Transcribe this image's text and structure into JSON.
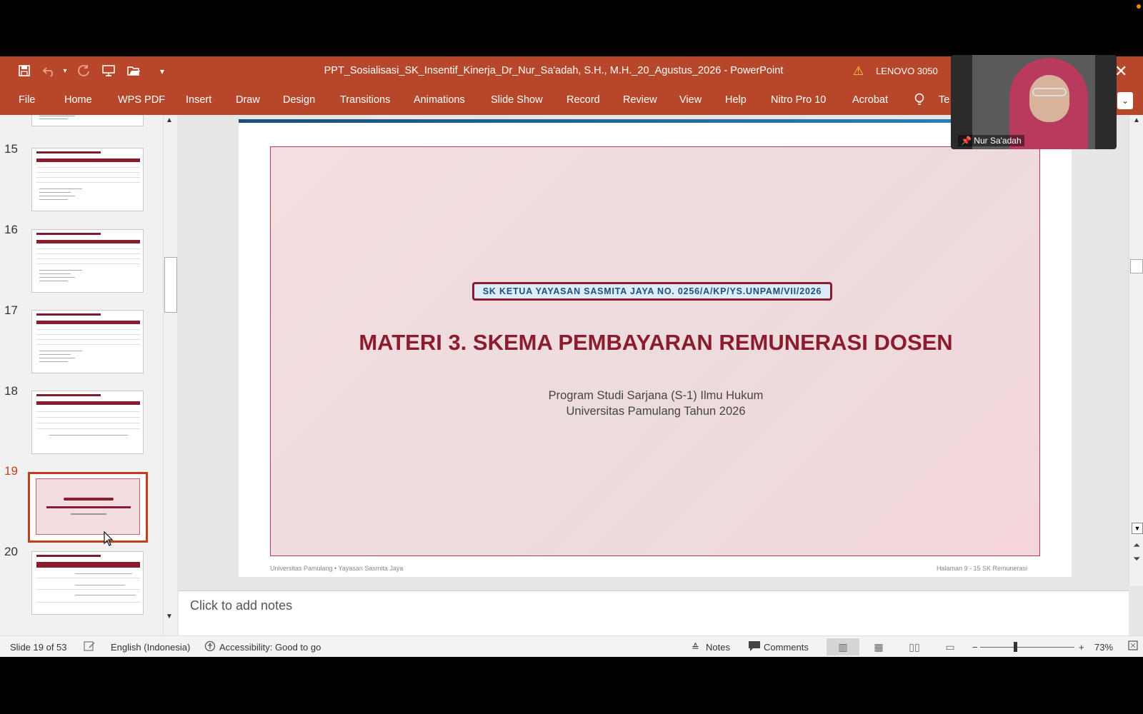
{
  "window": {
    "title": "PPT_Sosialisasi_SK_Insentif_Kinerja_Dr_Nur_Sa'adah, S.H., M.H._20_Agustus_2026  -  PowerPoint",
    "device_name": "LENOVO 3050",
    "close_glyph": "✕"
  },
  "quick_access": {
    "save_icon": "save-icon",
    "undo_icon": "undo-icon",
    "redo_icon": "redo-icon",
    "present_icon": "presentation-icon",
    "open_icon": "folder-open-icon",
    "customize_glyph": "▾"
  },
  "menu": {
    "items": [
      "File",
      "Home",
      "WPS PDF",
      "Insert",
      "Draw",
      "Design",
      "Transitions",
      "Animations",
      "Slide Show",
      "Record",
      "Review",
      "View",
      "Help",
      "Nitro Pro 10",
      "Acrobat"
    ],
    "tell_me": "Te"
  },
  "thumbnails": [
    {
      "num": "15"
    },
    {
      "num": "16"
    },
    {
      "num": "17"
    },
    {
      "num": "18"
    },
    {
      "num": "19"
    },
    {
      "num": "20"
    }
  ],
  "slide": {
    "sk_label": "SK KETUA YAYASAN SASMITA JAYA NO. 0256/A/KP/YS.UNPAM/VII/2026",
    "title": "MATERI 3. SKEMA PEMBAYARAN REMUNERASI DOSEN",
    "subtitle1": "Program Studi Sarjana (S-1) Ilmu Hukum",
    "subtitle2": "Universitas Pamulang Tahun 2026",
    "footer_left": "Universitas Pamulang • Yayasan Sasmita Jaya",
    "footer_right": "Halaman 9 - 15 SK Remunerasi"
  },
  "notes": {
    "placeholder": "Click to add notes"
  },
  "status": {
    "slide_counter": "Slide 19 of 53",
    "language": "English (Indonesia)",
    "accessibility": "Accessibility: Good to go",
    "notes_label": "Notes",
    "comments_label": "Comments",
    "zoom": "73%"
  },
  "video": {
    "participant": "Nur Sa'adah"
  },
  "colors": {
    "ribbon": "#b7472a",
    "slide_title": "#8a1c2e",
    "active_thumb": "#c43e1c"
  }
}
